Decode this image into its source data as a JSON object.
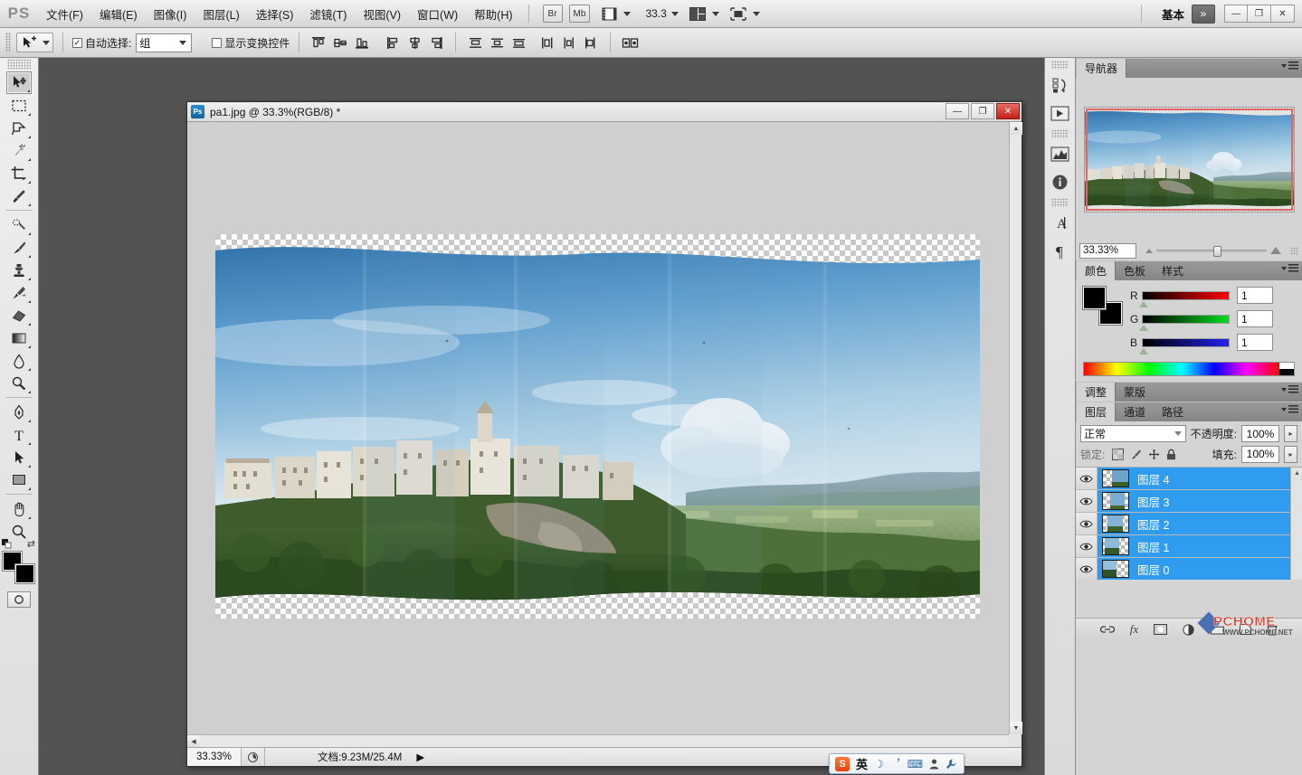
{
  "app": {
    "name": "Photoshop",
    "logo": "PS"
  },
  "menubar": {
    "items": [
      {
        "label": "文件(F)",
        "name": "menu-file"
      },
      {
        "label": "编辑(E)",
        "name": "menu-edit"
      },
      {
        "label": "图像(I)",
        "name": "menu-image"
      },
      {
        "label": "图层(L)",
        "name": "menu-layer"
      },
      {
        "label": "选择(S)",
        "name": "menu-select"
      },
      {
        "label": "滤镜(T)",
        "name": "menu-filter"
      },
      {
        "label": "视图(V)",
        "name": "menu-view"
      },
      {
        "label": "窗口(W)",
        "name": "menu-window"
      },
      {
        "label": "帮助(H)",
        "name": "menu-help"
      }
    ],
    "bridge_label": "Br",
    "minibridge_label": "Mb",
    "zoom_value": "33.3",
    "workspace_label": "基本",
    "chevron_label": "»",
    "window_buttons": {
      "minimize": "—",
      "restore": "❐",
      "close": "✕"
    }
  },
  "options": {
    "auto_select_label": "自动选择:",
    "auto_select_checked": "✓",
    "auto_select_value": "组",
    "show_transform_label": "显示变换控件",
    "show_transform_checked": "",
    "align_titles": [
      "顶对齐",
      "垂直居中对齐",
      "底对齐",
      "左对齐",
      "水平居中对齐",
      "右对齐",
      "按顶分布",
      "垂直居中分布",
      "按底分布",
      "按左分布",
      "水平居中分布",
      "按右分布",
      "自动对齐图层"
    ]
  },
  "toolbar": {
    "tools": [
      {
        "name": "move-tool",
        "label": "移动工具",
        "active": true
      },
      {
        "name": "marquee-tool",
        "label": "矩形选框工具",
        "active": false
      },
      {
        "name": "lasso-tool",
        "label": "套索工具",
        "active": false
      },
      {
        "name": "magic-wand-tool",
        "label": "魔棒工具",
        "active": false
      },
      {
        "name": "crop-tool",
        "label": "裁剪工具",
        "active": false
      },
      {
        "name": "eyedropper-tool",
        "label": "吸管工具",
        "active": false
      },
      {
        "name": "healing-brush-tool",
        "label": "污点修复画笔工具",
        "active": false
      },
      {
        "name": "brush-tool",
        "label": "画笔工具",
        "active": false
      },
      {
        "name": "clone-stamp-tool",
        "label": "仿制图章工具",
        "active": false
      },
      {
        "name": "history-brush-tool",
        "label": "历史记录画笔工具",
        "active": false
      },
      {
        "name": "eraser-tool",
        "label": "橡皮擦工具",
        "active": false
      },
      {
        "name": "gradient-tool",
        "label": "渐变工具",
        "active": false
      },
      {
        "name": "blur-tool",
        "label": "模糊工具",
        "active": false
      },
      {
        "name": "dodge-tool",
        "label": "减淡工具",
        "active": false
      },
      {
        "name": "pen-tool",
        "label": "钢笔工具",
        "active": false
      },
      {
        "name": "type-tool",
        "label": "横排文字工具",
        "active": false
      },
      {
        "name": "path-selection-tool",
        "label": "路径选择工具",
        "active": false
      },
      {
        "name": "rectangle-tool",
        "label": "矩形工具",
        "active": false
      },
      {
        "name": "hand-tool",
        "label": "抓手工具",
        "active": false
      },
      {
        "name": "zoom-tool",
        "label": "缩放工具",
        "active": false
      }
    ],
    "foreground_color": "#000000",
    "background_color": "#000000",
    "quickmask_label": "以快速蒙版模式编辑"
  },
  "document": {
    "title": "pa1.jpg @ 33.3%(RGB/8) *",
    "icon_label": "Ps",
    "window_buttons": {
      "minimize": "—",
      "maximize": "❐",
      "close": "✕"
    },
    "status": {
      "zoom": "33.33%",
      "doc_info": "文档:9.23M/25.4M",
      "arrow": "▶"
    }
  },
  "rail": {
    "items": [
      {
        "name": "history-icon",
        "label": "历史记录"
      },
      {
        "name": "mini-bridge-icon",
        "label": "Mini Bridge"
      },
      {
        "name": "histogram-icon",
        "label": "直方图"
      },
      {
        "name": "info-icon",
        "label": "信息"
      },
      {
        "name": "character-icon",
        "label": "字符"
      },
      {
        "name": "paragraph-icon",
        "label": "段落"
      }
    ]
  },
  "navigator": {
    "tabs": [
      {
        "label": "导航器",
        "active": true
      }
    ],
    "zoom_value": "33.33%",
    "view_rect_color": "#e06666"
  },
  "color_panel": {
    "tabs": [
      {
        "label": "颜色",
        "active": true
      },
      {
        "label": "色板",
        "active": false
      },
      {
        "label": "样式",
        "active": false
      }
    ],
    "channels": [
      {
        "label": "R",
        "value": "1",
        "color": "#ff0000"
      },
      {
        "label": "G",
        "value": "1",
        "color": "#00ff00"
      },
      {
        "label": "B",
        "value": "1",
        "color": "#0000ff"
      }
    ]
  },
  "adjustments_panel": {
    "tabs": [
      {
        "label": "调整",
        "active": true
      },
      {
        "label": "蒙版",
        "active": false
      }
    ]
  },
  "layers_panel": {
    "tabs": [
      {
        "label": "图层",
        "active": true
      },
      {
        "label": "通道",
        "active": false
      },
      {
        "label": "路径",
        "active": false
      }
    ],
    "blend_mode": "正常",
    "opacity_label": "不透明度:",
    "opacity_value": "100%",
    "lock_label": "锁定:",
    "fill_label": "填充:",
    "fill_value": "100%",
    "layers": [
      {
        "name": "图层 4",
        "visible": true,
        "selected": true
      },
      {
        "name": "图层 3",
        "visible": true,
        "selected": true
      },
      {
        "name": "图层 2",
        "visible": true,
        "selected": true
      },
      {
        "name": "图层 1",
        "visible": true,
        "selected": true
      },
      {
        "name": "图层 0",
        "visible": true,
        "selected": true
      }
    ],
    "bottom_buttons": [
      {
        "name": "link-layers-icon",
        "label": "链接图层"
      },
      {
        "name": "layer-style-icon",
        "label": "添加图层样式",
        "glyph": "fx"
      },
      {
        "name": "layer-mask-icon",
        "label": "添加图层蒙版"
      },
      {
        "name": "adjustment-layer-icon",
        "label": "创建新的填充或调整图层"
      },
      {
        "name": "new-group-icon",
        "label": "创建新组"
      },
      {
        "name": "new-layer-icon",
        "label": "创建新图层"
      },
      {
        "name": "delete-layer-icon",
        "label": "删除图层"
      }
    ]
  },
  "watermark": {
    "text": "PCHOME",
    "sub": "WWW.PCHOME.NET"
  },
  "ime": {
    "logo": "S",
    "mode": "英",
    "items": [
      {
        "name": "ime-moon-icon",
        "glyph": "☽"
      },
      {
        "name": "ime-punctuation-icon",
        "glyph": "︐"
      },
      {
        "name": "ime-keyboard-icon",
        "glyph": "⌨"
      },
      {
        "name": "ime-user-icon",
        "glyph": "👤"
      },
      {
        "name": "ime-tools-icon",
        "glyph": "🔧"
      }
    ]
  }
}
